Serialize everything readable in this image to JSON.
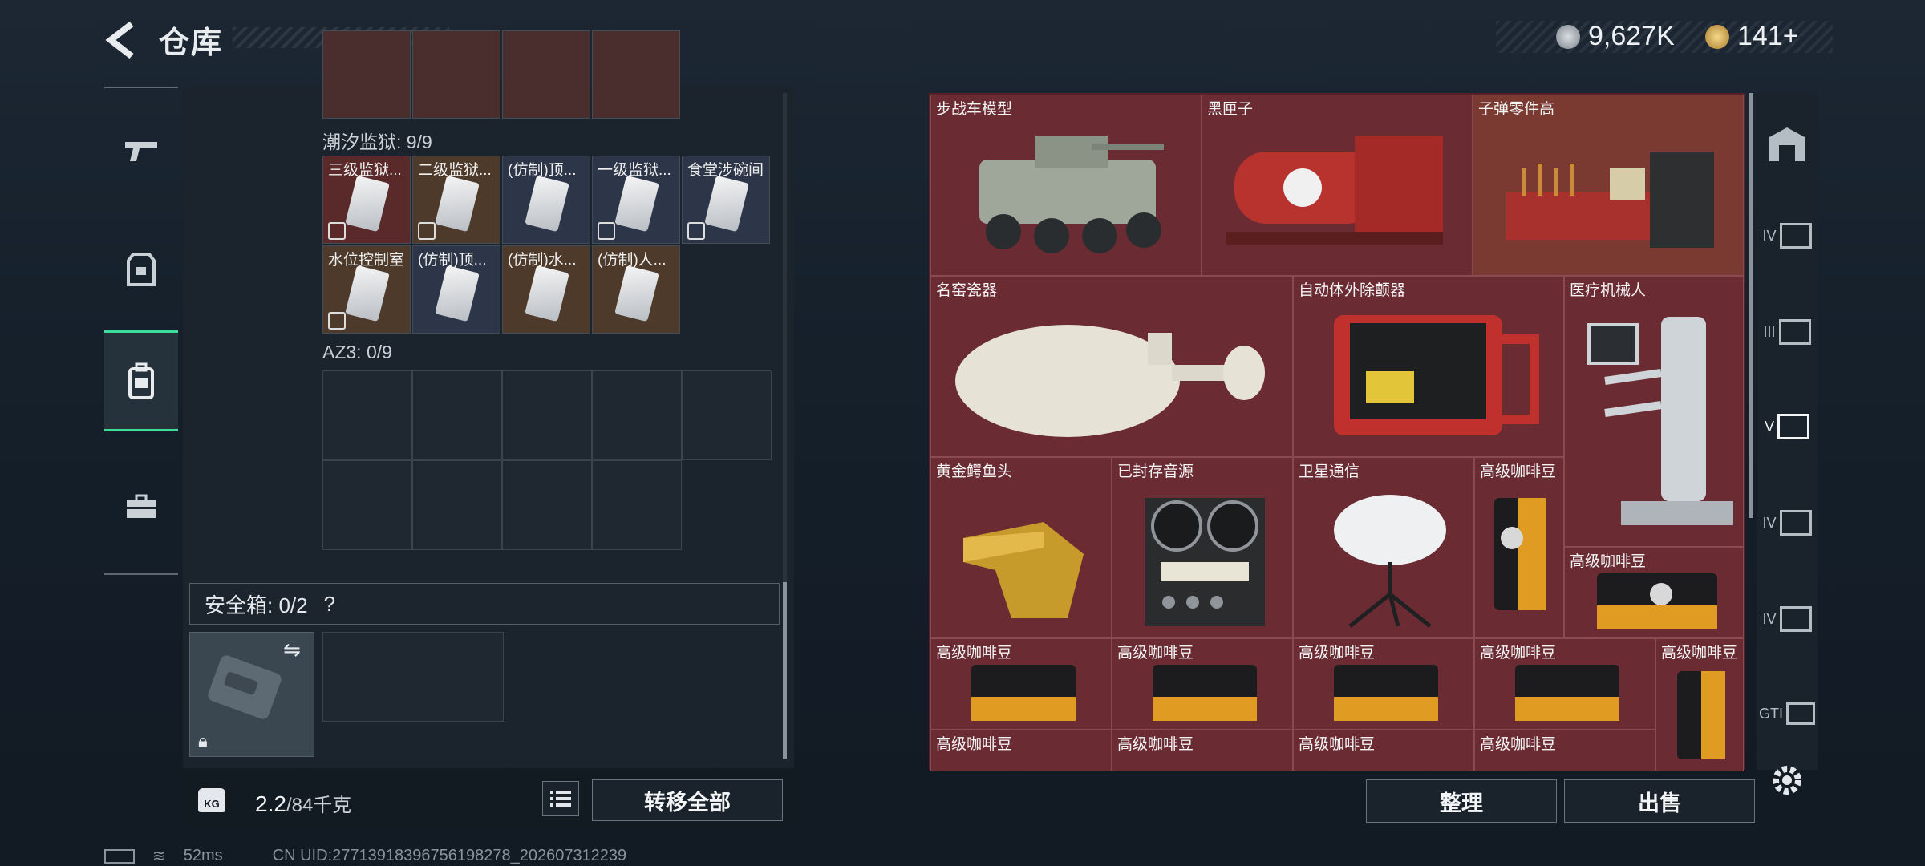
{
  "header": {
    "title": "仓库",
    "currency_1": "9,627K",
    "currency_2": "141+"
  },
  "left_rail": [
    "gun-icon",
    "armor-icon",
    "backpack-icon",
    "toolbox-icon"
  ],
  "storage": {
    "prison_label": "潮汐监狱: 9/9",
    "prison_items": [
      "三级监狱...",
      "二级监狱...",
      "(仿制)顶...",
      "一级监狱...",
      "食堂涉碗间",
      "水位控制室",
      "(仿制)顶...",
      "(仿制)水...",
      "(仿制)人..."
    ],
    "az3_label": "AZ3: 0/9",
    "safe_label": "安全箱: 0/2",
    "safe_help": "?",
    "weight_value": "2.2",
    "weight_max": "/84千克",
    "weight_icon_text": "KG",
    "transfer_all": "转移全部"
  },
  "loot": {
    "items": [
      "步战车模型",
      "黑匣子",
      "子弹零件高",
      "名窑瓷器",
      "自动体外除颤器",
      "医疗机械人",
      "黄金鳄鱼头",
      "已封存音源",
      "卫星通信",
      "高级咖啡豆",
      "高级咖啡豆",
      "高级咖啡豆",
      "高级咖啡豆",
      "高级咖啡豆",
      "高级咖啡豆",
      "高级咖啡豆",
      "高级咖啡豆",
      "高级咖啡豆",
      "高级咖啡豆",
      "高级咖啡豆"
    ],
    "sort_button": "整理",
    "sell_button": "出售"
  },
  "right_rail": [
    "IV",
    "III",
    "V",
    "IV",
    "IV",
    "GTI"
  ],
  "status": {
    "ping": "52ms",
    "uid": "CN UID:2771391839675619​8278_202607312239"
  },
  "colors": {
    "accent": "#3ddc97",
    "loot_bg": "#6b2b33",
    "panel": "#1b242d"
  }
}
